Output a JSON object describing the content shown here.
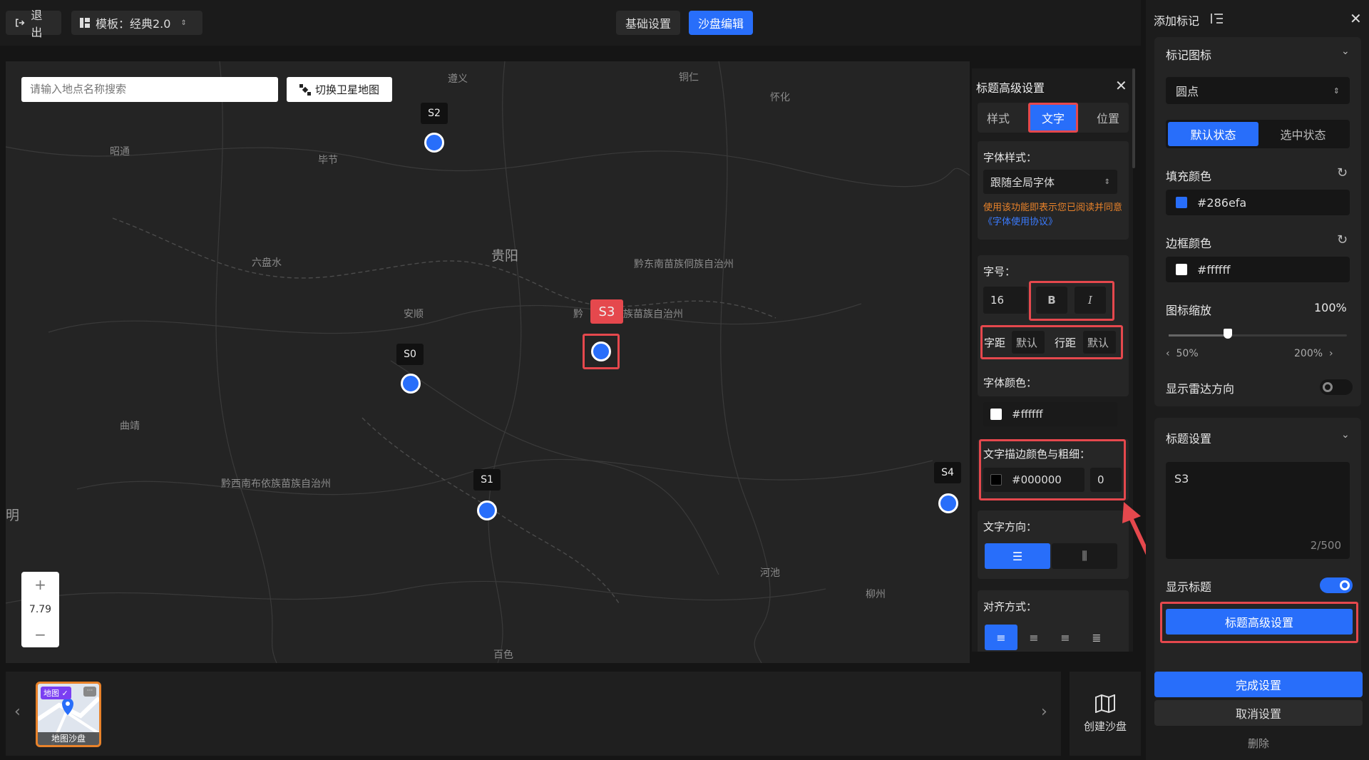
{
  "topbar": {
    "exit_label": "退出",
    "template_label": "模板：经典2.0",
    "tab_basic": "基础设置",
    "tab_sandbox": "沙盘编辑"
  },
  "map": {
    "search_placeholder": "请输入地点名称搜索",
    "satellite_label": "切换卫星地图",
    "zoom_plus": "+",
    "zoom_level": "7.79",
    "zoom_minus": "−",
    "cities": [
      "遵义",
      "铜仁",
      "怀化",
      "昭通",
      "毕节",
      "贵阳",
      "六盘水",
      "黔东南苗族侗族自治州",
      "安顺",
      "黔",
      "族苗族自治州",
      "曲靖",
      "黔西南布依族苗族自治州",
      "河池",
      "柳州",
      "百色",
      "明"
    ],
    "markers": [
      "S2",
      "S3",
      "S0",
      "S1",
      "S4"
    ]
  },
  "advanced": {
    "title": "标题高级设置",
    "tabs": [
      "样式",
      "文字",
      "位置"
    ],
    "font_style_label": "字体样式：",
    "font_style_value": "跟随全局字体",
    "notice": "使用该功能即表示您已阅读并同意",
    "notice_link": "《字体使用协议》",
    "size_label": "字号：",
    "size_value": "16",
    "bold_label": "B",
    "italic_label": "I",
    "letter_spacing_label": "字距",
    "letter_spacing_value": "默认",
    "line_spacing_label": "行距",
    "line_spacing_value": "默认",
    "font_color_label": "字体颜色：",
    "font_color_value": "#ffffff",
    "stroke_label": "文字描边颜色与粗细：",
    "stroke_color_value": "#000000",
    "stroke_width_value": "0",
    "direction_label": "文字方向：",
    "align_label": "对齐方式："
  },
  "panel": {
    "title": "添加标记",
    "marker_icon_label": "标记图标",
    "icon_select_value": "圆点",
    "state_default": "默认状态",
    "state_selected": "选中状态",
    "fill_color_label": "填充颜色",
    "fill_color_value": "#286efa",
    "border_color_label": "边框颜色",
    "border_color_value": "#ffffff",
    "icon_scale_label": "图标缩放",
    "icon_scale_value": "100%",
    "scale_min": "50%",
    "scale_max": "200%",
    "radar_label": "显示雷达方向",
    "title_settings_label": "标题设置",
    "title_text": "S3",
    "title_count": "2/500",
    "show_title_label": "显示标题",
    "advanced_btn": "标题高级设置",
    "done_btn": "完成设置",
    "cancel_btn": "取消设置",
    "delete_btn": "删除"
  },
  "bottom": {
    "thumb_tag": "地图",
    "thumb_label": "地图沙盘",
    "create_label": "创建沙盘"
  },
  "colors": {
    "accent": "#286efa",
    "highlight": "#e5484d",
    "notice": "#e8822a"
  },
  "scale_fraction": 0.33,
  "show_title_on": true,
  "radar_on": false
}
